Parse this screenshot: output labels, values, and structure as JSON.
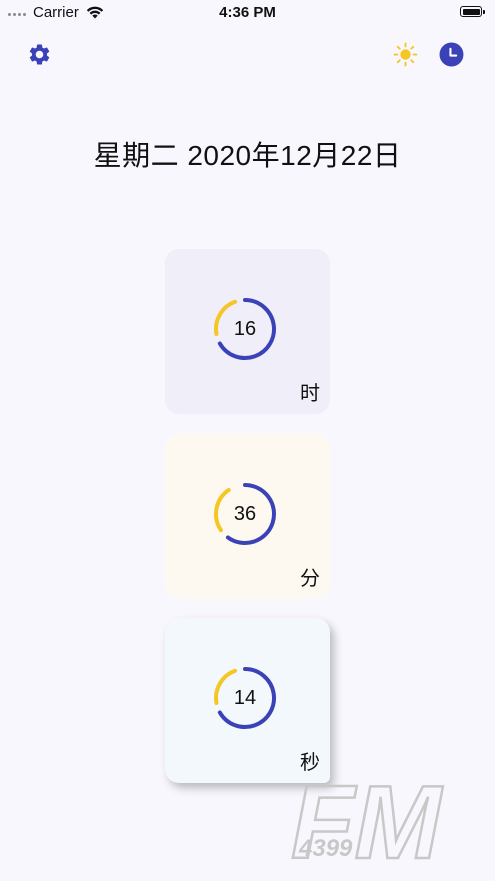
{
  "status_bar": {
    "carrier": "Carrier",
    "time": "4:36 PM"
  },
  "toolbar": {
    "settings_icon": "gear-icon",
    "theme_icon": "sun-icon",
    "clock_icon": "clock-icon"
  },
  "date": {
    "text": "星期二  2020年12月22日"
  },
  "cards": [
    {
      "value": "16",
      "unit": "时",
      "progress": 0.667,
      "background": "#f0eff9"
    },
    {
      "value": "36",
      "unit": "分",
      "progress": 0.6,
      "background": "#fdf9f1"
    },
    {
      "value": "14",
      "unit": "秒",
      "progress": 0.667,
      "background": "#f2f8fc"
    }
  ],
  "colors": {
    "accent_blue": "#3b42b8",
    "accent_yellow": "#f6c624",
    "text": "#111111"
  },
  "watermark": {
    "text": "FM",
    "subtext": "4399"
  }
}
